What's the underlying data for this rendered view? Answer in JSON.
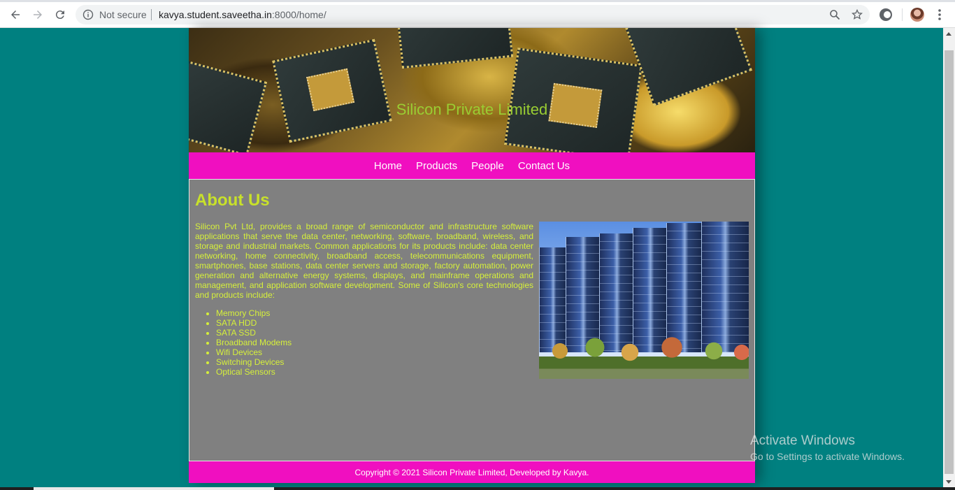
{
  "browser": {
    "security_label": "Not secure",
    "url_host": "kavya.student.saveetha.in",
    "url_rest": ":8000/home/"
  },
  "site": {
    "title": "Silicon Private Limited",
    "nav": [
      {
        "label": "Home"
      },
      {
        "label": "Products"
      },
      {
        "label": "People"
      },
      {
        "label": "Contact Us"
      }
    ],
    "about": {
      "heading": "About Us",
      "paragraph": "Silicon Pvt Ltd, provides a broad range of semiconductor and infrastructure software applications that serve the data center, networking, software, broadband, wireless, and storage and industrial markets. Common applications for its products include: data center networking, home connectivity, broadband access, telecommunications equipment, smartphones, base stations, data center servers and storage, factory automation, power generation and alternative energy systems, displays, and mainframe operations and management, and application software development. Some of Silicon's core technologies and products include:",
      "products": [
        "Memory Chips",
        "SATA HDD",
        "SATA SSD",
        "Broadband Modems",
        "Wifi Devices",
        "Switching Devices",
        "Optical Sensors"
      ]
    },
    "footer": "Copyright © 2021 Silicon Private Limited, Developed by Kavya."
  },
  "os": {
    "activate_title": "Activate Windows",
    "activate_sub": "Go to Settings to activate Windows."
  },
  "colors": {
    "page_bg": "#008080",
    "nav_bg": "#f00fc0",
    "content_bg": "#808080",
    "heading": "#c8e12a",
    "title": "#9acd32"
  }
}
